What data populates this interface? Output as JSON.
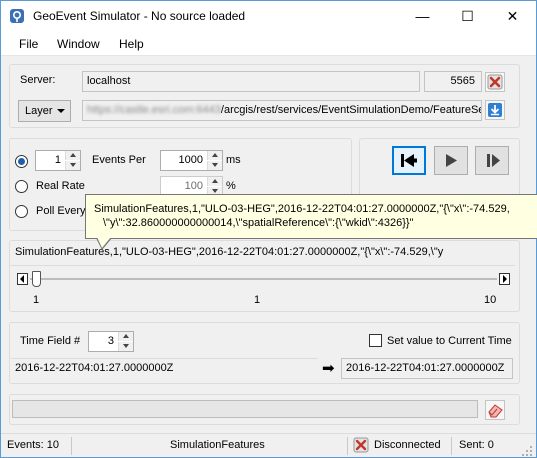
{
  "window": {
    "title": "GeoEvent Simulator - No source loaded",
    "controls": {
      "minimize": "—",
      "maximize": "☐",
      "close": "✕"
    }
  },
  "menu": [
    "File",
    "Window",
    "Help"
  ],
  "source": {
    "server_label": "Server:",
    "server_value": "localhost",
    "port_value": "5565",
    "layer_combo": "Layer",
    "url_masked": "https://castle.esri.com:6443",
    "url_value": "/arcgis/rest/services/EventSimulationDemo/FeatureSe"
  },
  "rate": {
    "events_count": "1",
    "events_per_label": "Events Per",
    "interval_value": "1000",
    "interval_unit": "ms",
    "real_rate_label": "Real Rate",
    "real_rate_value": "100",
    "real_rate_unit": "%",
    "poll_every_label": "Poll Every"
  },
  "tooltip": {
    "line1": "SimulationFeatures,1,\"ULO-03-HEG\",2016-12-22T04:01:27.0000000Z,\"{\\\"x\\\":-74.529,",
    "line2": "\\\"y\\\":32.860000000000014,\\\"spatialReference\\\":{\\\"wkid\\\":4326}}\""
  },
  "event_preview": {
    "text": "SimulationFeatures,1,\"ULO-03-HEG\",2016-12-22T04:01:27.0000000Z,\"{\\\"x\\\":-74.529,\\\"y",
    "slider_min": "1",
    "slider_current": "1",
    "slider_max": "10",
    "slider_position": 1
  },
  "time": {
    "field_label": "Time Field #",
    "field_value": "3",
    "set_current_label": "Set value to Current Time",
    "set_current_checked": false,
    "source_time": "2016-12-22T04:01:27.0000000Z",
    "arrow": "➡",
    "target_time": "2016-12-22T04:01:27.0000000Z"
  },
  "status": {
    "events": "Events: 10",
    "source_name": "SimulationFeatures",
    "connection": "Disconnected",
    "sent": "Sent: 0"
  },
  "colors": {
    "accent": "#0078d7",
    "disconnect_red": "#c0392b",
    "tooltip_bg": "#ffffe1"
  }
}
